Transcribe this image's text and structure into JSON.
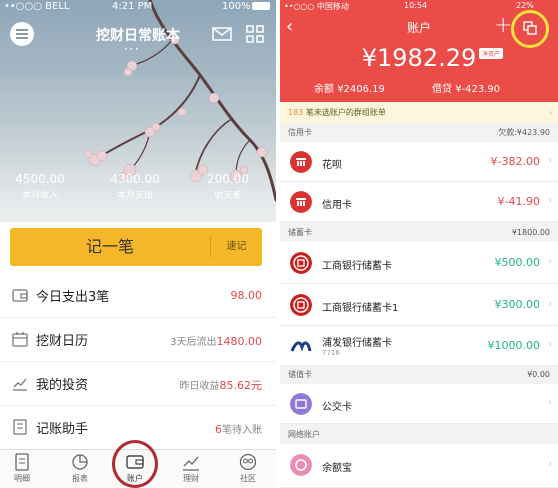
{
  "left": {
    "status": {
      "carrier": "••○○○ BELL",
      "time": "4:21 PM",
      "battery": "100%"
    },
    "title": "挖财日常账本",
    "page_dots": "•••",
    "stats": [
      {
        "value": "4500.00",
        "label": "本月收入"
      },
      {
        "value": "4300.00",
        "label": "本月支出"
      },
      {
        "value": "200.00",
        "label": "收支差"
      }
    ],
    "record_label": "记一笔",
    "quick_label": "速记",
    "rows": [
      {
        "title": "今日支出3笔",
        "right_prefix": "",
        "right_value": "98.00",
        "right_suffix": "",
        "icon": "wallet-icon"
      },
      {
        "title": "挖财日历",
        "right_prefix": "3天后流出",
        "right_value": "1480.00",
        "right_suffix": "",
        "icon": "calendar-icon"
      },
      {
        "title": "我的投资",
        "right_prefix": "昨日收益",
        "right_value": "85.62元",
        "right_suffix": "",
        "icon": "chart-icon"
      },
      {
        "title": "记账助手",
        "right_prefix": "",
        "right_value": "6",
        "right_suffix": "笔待入账",
        "icon": "notebook-icon"
      }
    ],
    "tabs": [
      {
        "label": "明细",
        "icon": "document-icon"
      },
      {
        "label": "报表",
        "icon": "pie-chart-icon"
      },
      {
        "label": "账户",
        "icon": "wallet-icon"
      },
      {
        "label": "理财",
        "icon": "trend-icon"
      },
      {
        "label": "社区",
        "icon": "community-icon"
      }
    ],
    "colors": {
      "accent": "#f4b729",
      "ring": "#b32a2e",
      "negative": "#e24a4a"
    }
  },
  "right": {
    "status": {
      "carrier": "••○○○ 中国移动",
      "time": "10:54",
      "battery": "22%"
    },
    "title": "账户",
    "net_value": "¥1982.29",
    "net_badge": "净资产",
    "balance_label": "余额",
    "balance_value": "¥2406.19",
    "debt_label": "借贷",
    "debt_value": "¥-423.90",
    "notice_count": "183",
    "notice_text": "笔未选账户的群组账单",
    "notice_arrow": "›",
    "sections": {
      "credit": {
        "label": "信用卡",
        "value": "欠款:¥423.90"
      },
      "debit": {
        "label": "储蓄卡",
        "value": "¥1800.00"
      },
      "stored": {
        "label": "储值卡",
        "value": "¥0.00"
      },
      "online": {
        "label": "网络账户"
      }
    },
    "accounts": {
      "huabei": {
        "name": "花呗",
        "value": "¥-382.00"
      },
      "credit_card": {
        "name": "信用卡",
        "value": "¥-41.90"
      },
      "icbc1": {
        "name": "工商银行储蓄卡",
        "value": "¥500.00"
      },
      "icbc2": {
        "name": "工商银行储蓄卡1",
        "value": "¥300.00"
      },
      "spdb": {
        "name": "浦发银行储蓄卡",
        "desc": "7716",
        "value": "¥1000.00"
      },
      "transit": {
        "name": "公交卡"
      },
      "yuebao": {
        "name": "余额宝"
      }
    },
    "colors": {
      "header": "#ec4c48",
      "ring": "#f3e33a",
      "positive": "#1fb48f",
      "negative": "#e24a4a"
    }
  }
}
